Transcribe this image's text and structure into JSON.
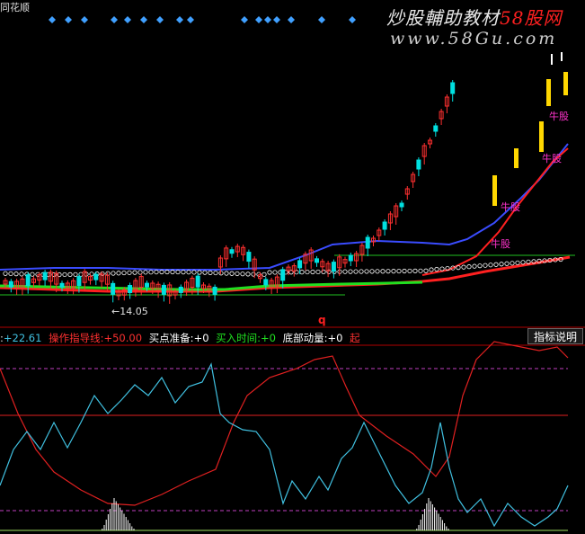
{
  "header": {
    "title_fragment": "同花顺"
  },
  "watermark": {
    "cn_white": "炒股輔助教材",
    "cn_red": "58股网",
    "url": "www.58Gu.com"
  },
  "price_panel": {
    "low_marker": "←14.05",
    "signal_label": "牛股",
    "q_marker": "q"
  },
  "indicator_bar": {
    "value_prefix": ":",
    "value": "+22.61",
    "guide_label": "操作指导线:",
    "guide_value": "+50.00",
    "buy_prep_label": "买点准备:",
    "buy_prep_value": "+0",
    "buy_time_label": "买入时间:",
    "buy_time_value": "+0",
    "bottom_momentum_label": "底部动量:",
    "bottom_momentum_value": "+0",
    "start_label": "起"
  },
  "help_button": {
    "label": "指标说明"
  },
  "colors": {
    "background": "#000000",
    "up_candle": "#ff3030",
    "down_candle": "#00e0e0",
    "signal_bar": "#ffd700",
    "ma_red": "#ff2020",
    "ma_blue": "#3a4cff",
    "ma_green": "#20e020",
    "osc_cyan": "#40c0e0",
    "osc_red": "#e02020"
  }
}
